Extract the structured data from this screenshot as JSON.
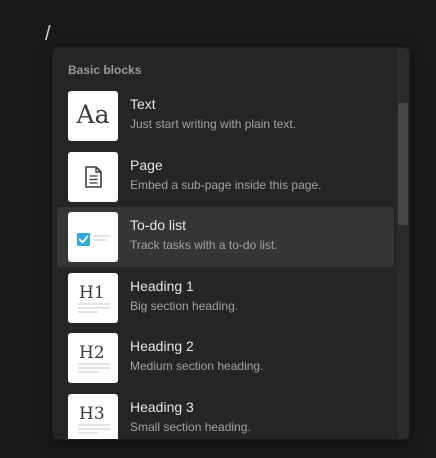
{
  "editor": {
    "slash_text": "/"
  },
  "menu": {
    "section_title": "Basic blocks",
    "items": [
      {
        "label": "Text",
        "description": "Just start writing with plain text.",
        "icon": "text-icon",
        "thumb_text": "Aa",
        "selected": false
      },
      {
        "label": "Page",
        "description": "Embed a sub-page inside this page.",
        "icon": "page-icon",
        "selected": false
      },
      {
        "label": "To-do list",
        "description": "Track tasks with a to-do list.",
        "icon": "checkbox-icon",
        "selected": true
      },
      {
        "label": "Heading 1",
        "description": "Big section heading.",
        "icon": "heading-1-icon",
        "thumb_text": "H1",
        "selected": false
      },
      {
        "label": "Heading 2",
        "description": "Medium section heading.",
        "icon": "heading-2-icon",
        "thumb_text": "H2",
        "selected": false
      },
      {
        "label": "Heading 3",
        "description": "Small section heading.",
        "icon": "heading-3-icon",
        "thumb_text": "H3",
        "selected": false
      }
    ]
  },
  "colors": {
    "background": "#191919",
    "menu_background": "#252525",
    "selected_background": "#353535",
    "checkbox_accent": "#2eaadc"
  }
}
